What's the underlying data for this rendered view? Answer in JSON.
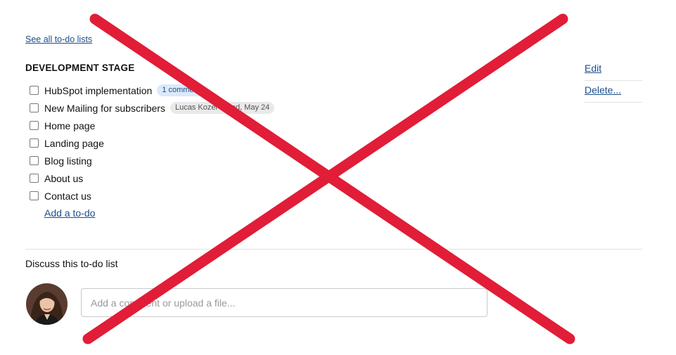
{
  "nav": {
    "see_all_label": "See all to-do lists"
  },
  "list": {
    "title": "DEVELOPMENT STAGE",
    "actions": {
      "edit_label": "Edit",
      "delete_label": "Delete..."
    },
    "todos": [
      {
        "label": "HubSpot implementation",
        "badges": [
          {
            "text": "1 comment",
            "kind": "comment"
          }
        ]
      },
      {
        "label": "New Mailing for subscribers",
        "badges": [
          {
            "text": "Lucas Kozel · Wed, May 24",
            "kind": "assign"
          }
        ]
      },
      {
        "label": "Home page",
        "badges": []
      },
      {
        "label": "Landing page",
        "badges": []
      },
      {
        "label": "Blog listing",
        "badges": []
      },
      {
        "label": "About us",
        "badges": []
      },
      {
        "label": "Contact us",
        "badges": []
      }
    ],
    "add_todo_label": "Add a to-do"
  },
  "discussion": {
    "title": "Discuss this to-do list",
    "input_placeholder": "Add a comment or upload a file..."
  },
  "colors": {
    "link": "#1b4f8a",
    "overlay_x": "#e11d37",
    "comment_badge_bg": "#dbe9fb",
    "assign_badge_bg": "#e9e9e9"
  },
  "icons": {
    "overlay": "x-cross-mark-icon",
    "avatar": "user-avatar-photo"
  }
}
